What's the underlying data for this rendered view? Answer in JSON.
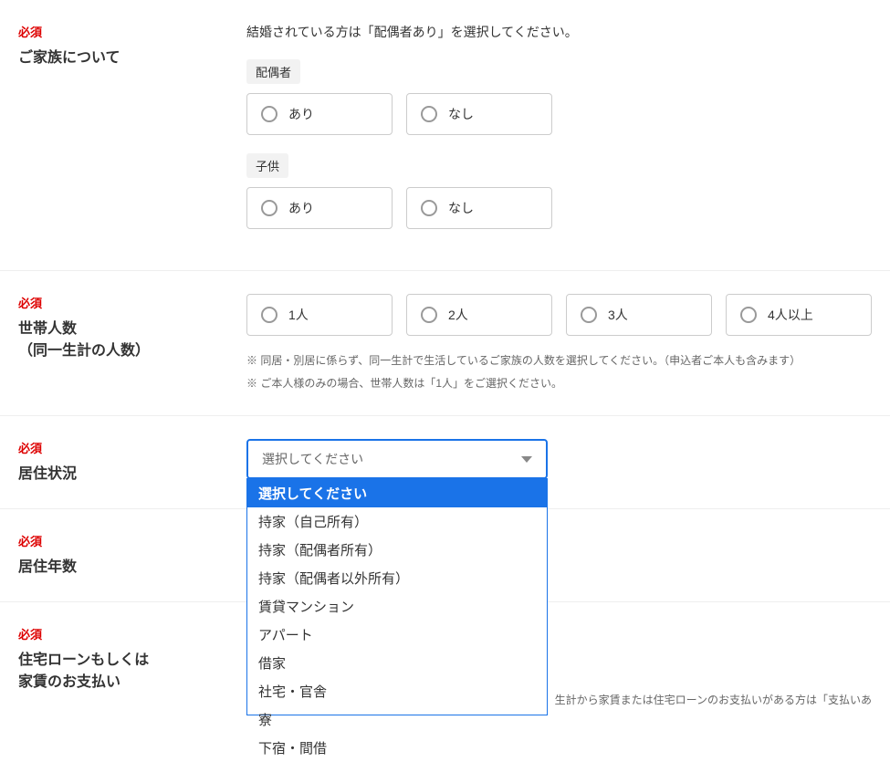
{
  "labels": {
    "required": "必須"
  },
  "family": {
    "title": "ご家族について",
    "instruction": "結婚されている方は「配偶者あり」を選択してください。",
    "spouse": {
      "label": "配偶者",
      "options": {
        "yes": "あり",
        "no": "なし"
      }
    },
    "children": {
      "label": "子供",
      "options": {
        "yes": "あり",
        "no": "なし"
      }
    }
  },
  "household": {
    "title": "世帯人数\n（同一生計の人数）",
    "options": {
      "o1": "1人",
      "o2": "2人",
      "o3": "3人",
      "o4": "4人以上"
    },
    "note1": "※ 同居・別居に係らず、同一生計で生活しているご家族の人数を選択してください。（申込者ご本人も含みます）",
    "note2": "※ ご本人様のみの場合、世帯人数は「1人」をご選択ください。"
  },
  "residence": {
    "title": "居住状況",
    "placeholder": "選択してください",
    "options": [
      "選択してください",
      "持家（自己所有）",
      "持家（配偶者所有）",
      "持家（配偶者以外所有）",
      "賃貸マンション",
      "アパート",
      "借家",
      "社宅・官舎",
      "寮",
      "下宿・間借"
    ]
  },
  "years": {
    "title": "居住年数"
  },
  "loan": {
    "title": "住宅ローンもしくは\n家賃のお支払い",
    "note": "生計から家賃または住宅ローンのお支払いがある方は「支払いあ"
  }
}
